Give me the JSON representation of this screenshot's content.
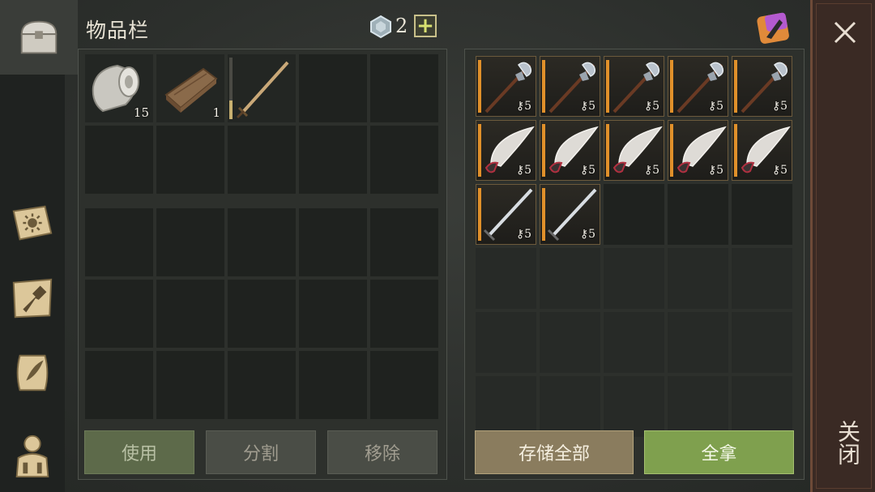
{
  "inventory": {
    "title": "物品栏",
    "gem_count": "2",
    "plus_label": "+",
    "items": [
      {
        "icon": "cloth-roll-icon",
        "qty": "15"
      },
      {
        "icon": "wood-plank-icon",
        "qty": "1"
      },
      {
        "icon": "sword-icon",
        "qty": "",
        "durability": 0.3
      }
    ],
    "buttons": {
      "use": "使用",
      "split": "分割",
      "remove": "移除"
    }
  },
  "storage": {
    "rows": [
      {
        "type": "halberd-icon",
        "count": 5,
        "ammo": "5"
      },
      {
        "type": "scimitar-icon",
        "count": 5,
        "ammo": "5"
      },
      {
        "type": "sword-icon",
        "count": 2,
        "ammo": "5"
      }
    ],
    "buttons": {
      "store_all": "存储全部",
      "take_all": "全拿"
    }
  },
  "close": {
    "label": "关闭"
  },
  "colors": {
    "accent_orange": "#e0902a",
    "take_green": "#7fa04e",
    "store_tan": "#8a7c5e"
  }
}
